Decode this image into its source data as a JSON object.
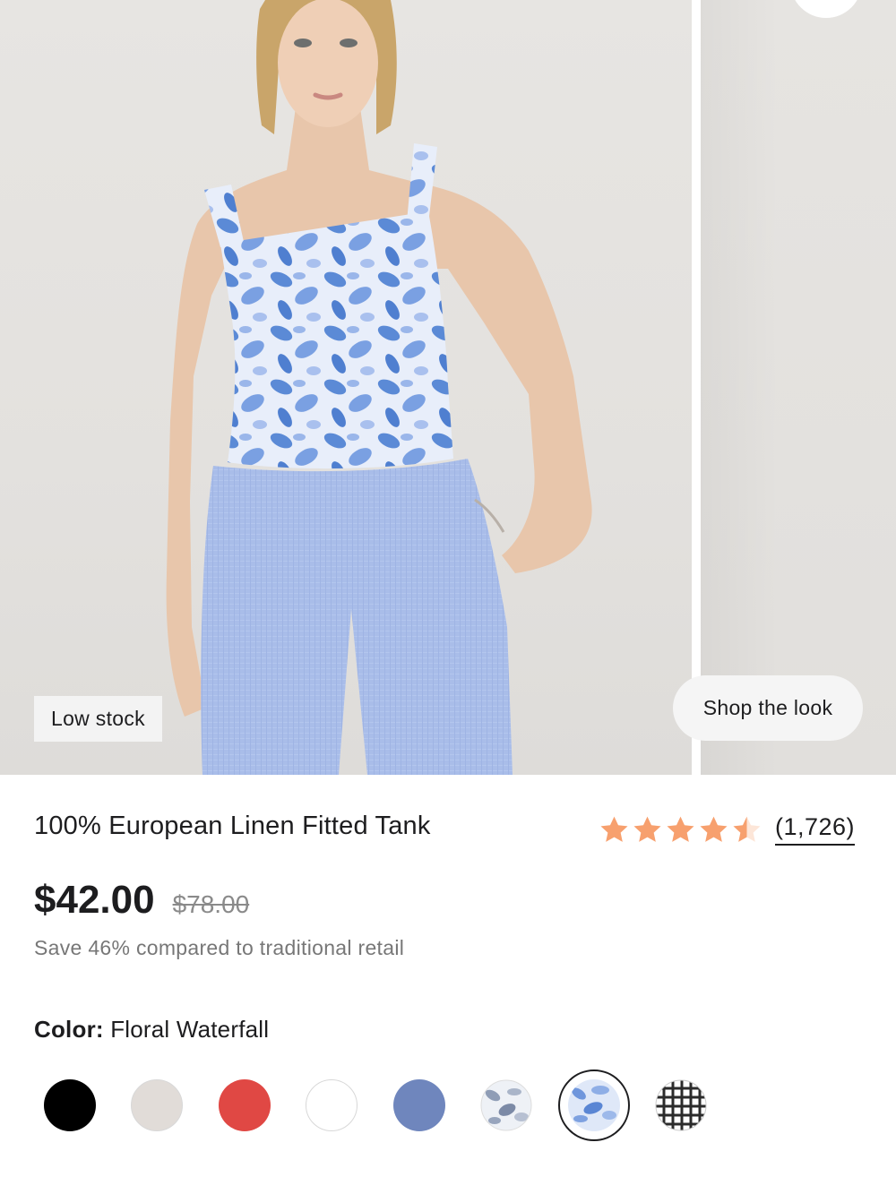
{
  "gallery": {
    "badge": "Low stock",
    "shop_the_look": "Shop the look"
  },
  "product": {
    "title": "100% European Linen Fitted Tank",
    "rating": 4.5,
    "rating_max": 5,
    "review_count": "(1,726)",
    "price": "$42.00",
    "original_price": "$78.00",
    "savings_note": "Save 46% compared to traditional retail",
    "color_label": "Color:",
    "color_value": "Floral Waterfall"
  },
  "colors": {
    "star": "#f7a06e",
    "text": "#1d1d1f"
  },
  "swatches": [
    {
      "name": "black",
      "color": "#000000"
    },
    {
      "name": "stone",
      "color": "#e1dcd8"
    },
    {
      "name": "red",
      "color": "#e04844"
    },
    {
      "name": "white",
      "color": "#ffffff"
    },
    {
      "name": "slate-blue",
      "color": "#6f86bd"
    },
    {
      "name": "grey-floral",
      "color": "#dde2ec"
    },
    {
      "name": "floral-waterfall",
      "color": "#b8ccee",
      "selected": true
    },
    {
      "name": "black-check",
      "color": "#ffffff"
    }
  ]
}
